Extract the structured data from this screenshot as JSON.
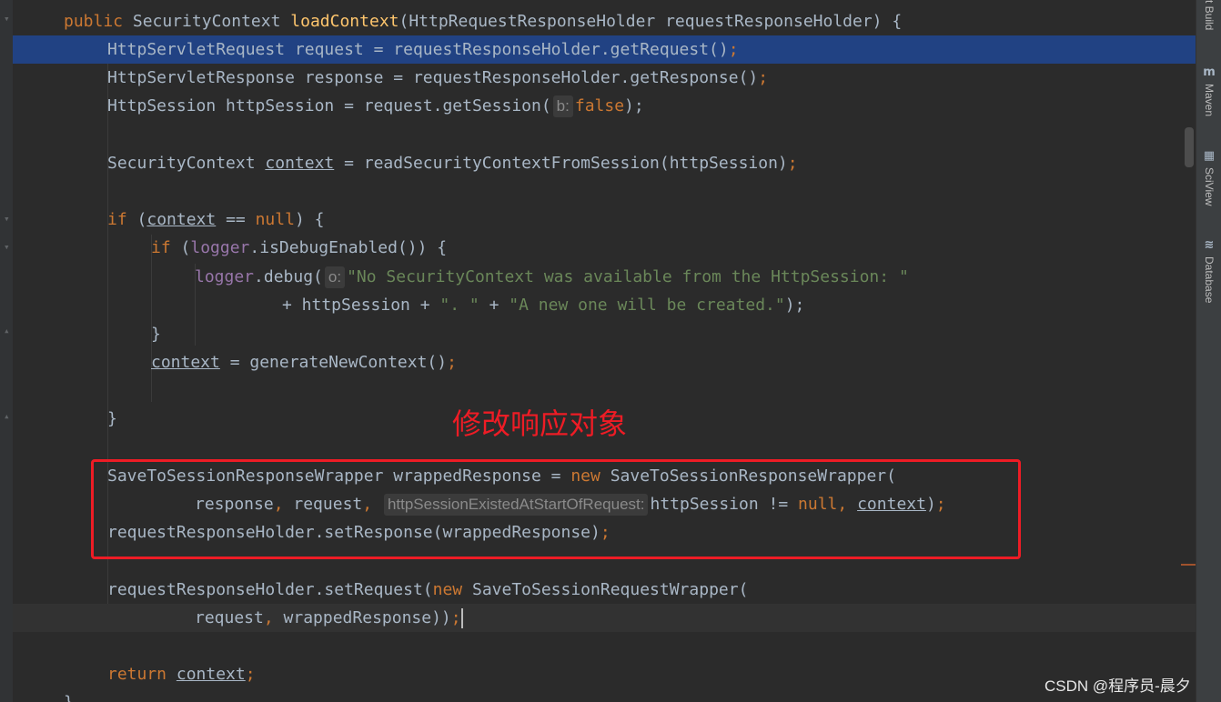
{
  "code": {
    "line1": {
      "kw": "public",
      "type": "SecurityContext",
      "method": "loadContext",
      "params": "(HttpRequestResponseHolder requestResponseHolder) {"
    },
    "line2": {
      "a": "HttpServletRequest request = requestResponseHolder.getRequest()",
      "semi": ";"
    },
    "line3": {
      "a": "HttpServletResponse response = requestResponseHolder.getResponse()",
      "semi": ";"
    },
    "line4": {
      "a": "HttpSession httpSession = request.getSession(",
      "hint": "b:",
      "kw": "false",
      "end": ");"
    },
    "line5": {
      "a": "SecurityContext ",
      "var": "context",
      "b": " = readSecurityContextFromSession(httpSession)",
      "semi": ";"
    },
    "line6": {
      "kw": "if",
      "a": " (",
      "var": "context",
      "b": " == ",
      "null": "null",
      "c": ") {"
    },
    "line7": {
      "kw": "if",
      "a": " (",
      "field": "logger",
      "b": ".isDebugEnabled()) {"
    },
    "line8": {
      "field": "logger",
      "a": ".debug(",
      "hint": "o:",
      "str": "\"No SecurityContext was available from the HttpSession: \""
    },
    "line9": {
      "a": "+ httpSession + ",
      "s1": "\". \"",
      "b": " + ",
      "s2": "\"A new one will be created.\"",
      "c": ");"
    },
    "line10": {
      "a": "}"
    },
    "line11": {
      "var": "context",
      "a": " = generateNewContext()",
      "semi": ";"
    },
    "line12": {
      "a": "}"
    },
    "line13": {
      "a": "SaveToSessionResponseWrapper wrappedResponse = ",
      "kw": "new",
      "b": " SaveToSessionResponseWrapper("
    },
    "line14": {
      "a": "response",
      "comma1": ",",
      "b": " request",
      "comma2": ",",
      "hint": "httpSessionExistedAtStartOfRequest:",
      "c": "httpSession != ",
      "null": "null",
      "comma3": ",",
      "var": "context",
      "d": ")",
      "semi": ";"
    },
    "line15": {
      "a": "requestResponseHolder.setResponse(wrappedResponse)",
      "semi": ";"
    },
    "line16": {
      "a": "requestResponseHolder.setRequest(",
      "kw": "new",
      "b": " SaveToSessionRequestWrapper("
    },
    "line17": {
      "a": "request",
      "comma": ",",
      "b": " wrappedResponse))",
      "semi": ";"
    },
    "line18": {
      "kw": "return",
      "var": "context",
      "semi": ";"
    },
    "line19": {
      "a": "}"
    }
  },
  "annotation": "修改响应对象",
  "watermark": "CSDN @程序员-晨夕",
  "sidebar": {
    "items": [
      {
        "label": "t Build",
        "icon": "build-icon"
      },
      {
        "label": "Maven",
        "icon": "maven-icon"
      },
      {
        "label": "SciView",
        "icon": "sciview-icon"
      },
      {
        "label": "Database",
        "icon": "database-icon"
      }
    ]
  },
  "colors": {
    "background": "#2b2b2b",
    "keyword": "#cc7832",
    "method_decl": "#ffc66d",
    "field": "#9876aa",
    "string": "#6a8759",
    "text": "#a9b7c6",
    "selection": "#214283",
    "annotation_red": "#ee1c25"
  }
}
